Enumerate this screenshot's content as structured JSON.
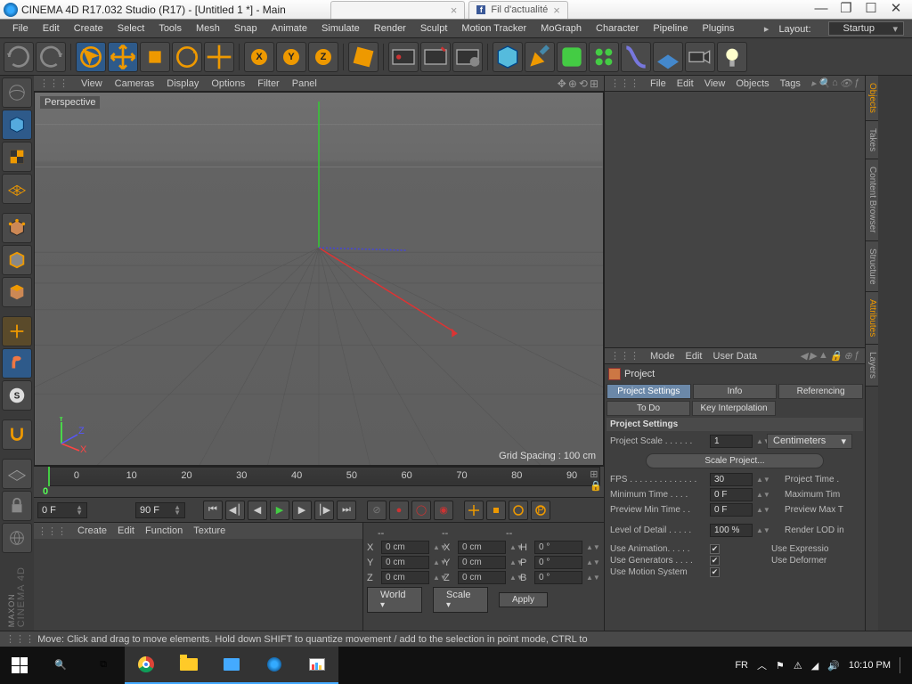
{
  "window": {
    "title": "CINEMA 4D R17.032 Studio (R17) - [Untitled 1 *] - Main",
    "browser_tab": "Fil d'actualité"
  },
  "menubar": [
    "File",
    "Edit",
    "Create",
    "Select",
    "Tools",
    "Mesh",
    "Snap",
    "Animate",
    "Simulate",
    "Render",
    "Sculpt",
    "Motion Tracker",
    "MoGraph",
    "Character",
    "Pipeline",
    "Plugins",
    "Layout:"
  ],
  "layout_label": "Layout:",
  "layout_value": "Startup",
  "viewport": {
    "menus": [
      "View",
      "Cameras",
      "Display",
      "Options",
      "Filter",
      "Panel"
    ],
    "label": "Perspective",
    "status": "Grid Spacing : 100 cm"
  },
  "timeline": {
    "ticks": [
      "0",
      "10",
      "20",
      "30",
      "40",
      "50",
      "60",
      "70",
      "80",
      "90"
    ],
    "start_frame": "0 F",
    "end_frame": "90 F",
    "current_frame": "0 F",
    "marker": "0"
  },
  "props_menu": [
    "Create",
    "Edit",
    "Function",
    "Texture"
  ],
  "coords": {
    "labels": [
      "X",
      "Y",
      "Z"
    ],
    "pos": [
      "0 cm",
      "0 cm",
      "0 cm"
    ],
    "size": [
      "0 cm",
      "0 cm",
      "0 cm"
    ],
    "rot_lbl": [
      "H",
      "P",
      "B"
    ],
    "rot": [
      "0 °",
      "0 °",
      "0 °"
    ],
    "mode1": "World",
    "mode2": "Scale",
    "apply": "Apply",
    "dash": "--"
  },
  "objects_menu": [
    "File",
    "Edit",
    "View",
    "Objects",
    "Tags"
  ],
  "attributes": {
    "menus": [
      "Mode",
      "Edit",
      "User Data"
    ],
    "project_label": "Project",
    "tabs_row1": [
      "Project Settings",
      "Info",
      "Referencing"
    ],
    "tabs_row2": [
      "To Do",
      "Key Interpolation"
    ],
    "section": "Project Settings",
    "scale_label": "Project Scale . . . . . .",
    "scale_value": "1",
    "scale_unit": "Centimeters",
    "scale_button": "Scale Project...",
    "fps_label": "FPS . . . . . . . . . . . . . .",
    "fps_value": "30",
    "proj_time_label": "Project Time .",
    "min_time_label": "Minimum Time . . . .",
    "min_time_value": "0 F",
    "max_time_label": "Maximum Tim",
    "prev_min_label": "Preview Min Time . .",
    "prev_min_value": "0 F",
    "prev_max_label": "Preview Max T",
    "lod_label": "Level of Detail . . . . .",
    "lod_value": "100 %",
    "render_lod_label": "Render LOD in",
    "use_anim": "Use Animation. . . . .",
    "use_expr": "Use Expressio",
    "use_gen": "Use Generators . . . .",
    "use_def": "Use Deformer",
    "use_motion": "Use Motion System"
  },
  "side_tabs": [
    "Objects",
    "Takes",
    "Content Browser",
    "Structure",
    "Attributes",
    "Layers"
  ],
  "status": "Move: Click and drag to move elements. Hold down SHIFT to quantize movement / add to the selection in point mode, CTRL to",
  "taskbar": {
    "lang": "FR",
    "time": "10:10 PM"
  }
}
